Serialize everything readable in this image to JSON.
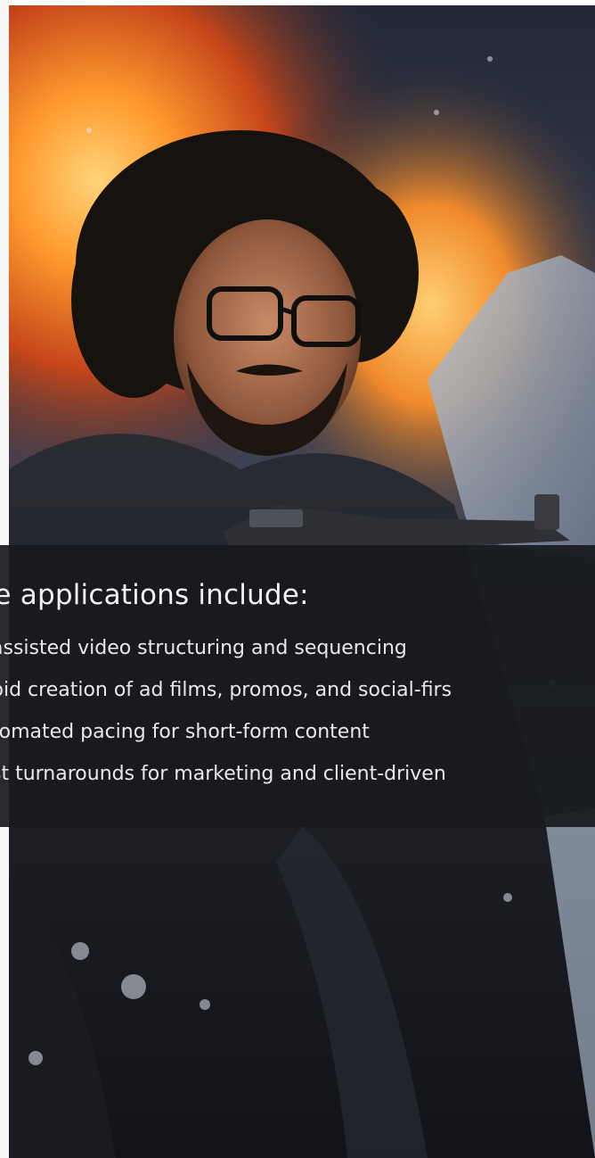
{
  "hero": {
    "image_description_icon": "portrait-photo-icon"
  },
  "overlay": {
    "heading": "ore applications include:",
    "items": [
      {
        "bullet": "•",
        "text": "assisted video structuring and sequencing"
      },
      {
        "bullet": "•",
        "text": "pid creation of ad films, promos, and social-firs"
      },
      {
        "bullet": "•",
        "text": "tomated pacing for short-form content"
      },
      {
        "bullet": "•",
        "text": "st turnarounds for marketing and client-driven"
      }
    ]
  },
  "colors": {
    "overlay_bg": "#181a1e",
    "text": "#f2f2f2",
    "fire": "#ff8c2a",
    "sky": "#2b3346"
  }
}
